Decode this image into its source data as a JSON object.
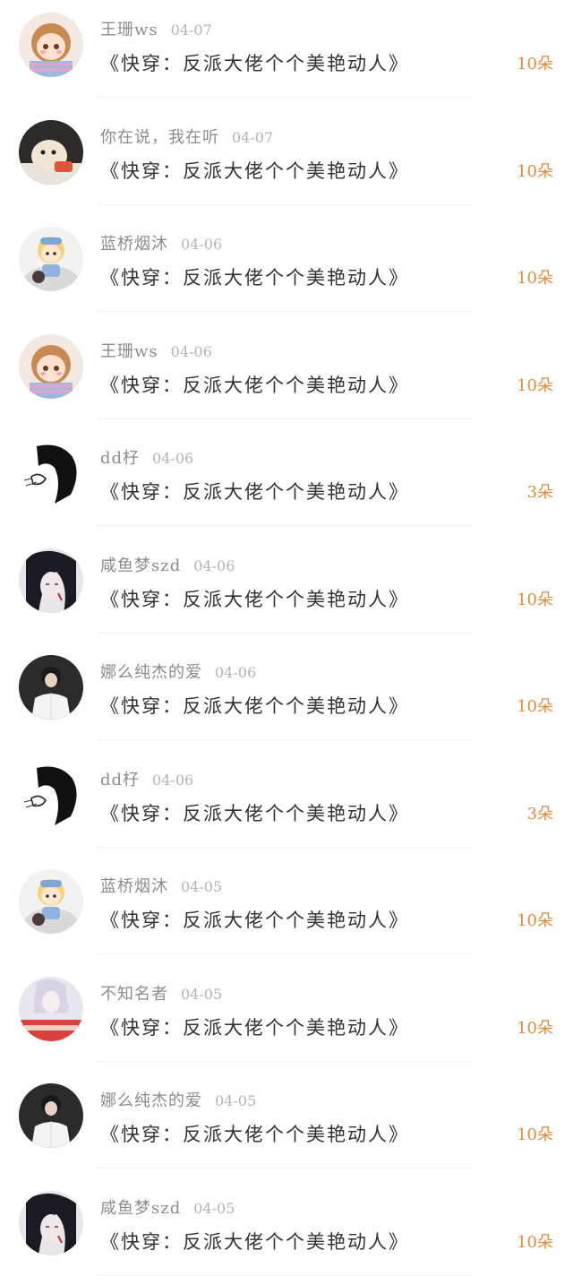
{
  "gift_list": {
    "items": [
      {
        "avatar_icon": "avatar-anime-girl-icon",
        "username": "王珊ws",
        "date": "04-07",
        "book_title": "《快穿：反派大佬个个美艳动人》",
        "amount": "10朵"
      },
      {
        "avatar_icon": "avatar-plush-toy-icon",
        "username": "你在说，我在听",
        "date": "04-07",
        "book_title": "《快穿：反派大佬个个美艳动人》",
        "amount": "10朵"
      },
      {
        "avatar_icon": "avatar-chibi-boy-icon",
        "username": "蓝桥烟沐",
        "date": "04-06",
        "book_title": "《快穿：反派大佬个个美艳动人》",
        "amount": "10朵"
      },
      {
        "avatar_icon": "avatar-anime-girl-icon",
        "username": "王珊ws",
        "date": "04-06",
        "book_title": "《快穿：反派大佬个个美艳动人》",
        "amount": "10朵"
      },
      {
        "avatar_icon": "avatar-sketch-icon",
        "username": "dd杍",
        "date": "04-06",
        "book_title": "《快穿：反派大佬个个美艳动人》",
        "amount": "3朵"
      },
      {
        "avatar_icon": "avatar-dark-hair-icon",
        "username": "咸鱼梦szd",
        "date": "04-06",
        "book_title": "《快穿：反派大佬个个美艳动人》",
        "amount": "10朵"
      },
      {
        "avatar_icon": "avatar-white-shirt-icon",
        "username": "娜么纯杰的爱",
        "date": "04-06",
        "book_title": "《快穿：反派大佬个个美艳动人》",
        "amount": "10朵"
      },
      {
        "avatar_icon": "avatar-sketch-icon",
        "username": "dd杍",
        "date": "04-06",
        "book_title": "《快穿：反派大佬个个美艳动人》",
        "amount": "3朵"
      },
      {
        "avatar_icon": "avatar-chibi-boy-icon",
        "username": "蓝桥烟沐",
        "date": "04-05",
        "book_title": "《快穿：反派大佬个个美艳动人》",
        "amount": "10朵"
      },
      {
        "avatar_icon": "avatar-book-cover-icon",
        "username": "不知名者",
        "date": "04-05",
        "book_title": "《快穿：反派大佬个个美艳动人》",
        "amount": "10朵"
      },
      {
        "avatar_icon": "avatar-white-shirt-icon",
        "username": "娜么纯杰的爱",
        "date": "04-05",
        "book_title": "《快穿：反派大佬个个美艳动人》",
        "amount": "10朵"
      },
      {
        "avatar_icon": "avatar-dark-hair-icon",
        "username": "咸鱼梦szd",
        "date": "04-05",
        "book_title": "《快穿：反派大佬个个美艳动人》",
        "amount": "10朵"
      }
    ]
  },
  "colors": {
    "username": "#8c8c8c",
    "date": "#b4b4b4",
    "title": "#333333",
    "amount": "#e58a3c",
    "divider": "#f1f1f1",
    "background": "#ffffff"
  }
}
